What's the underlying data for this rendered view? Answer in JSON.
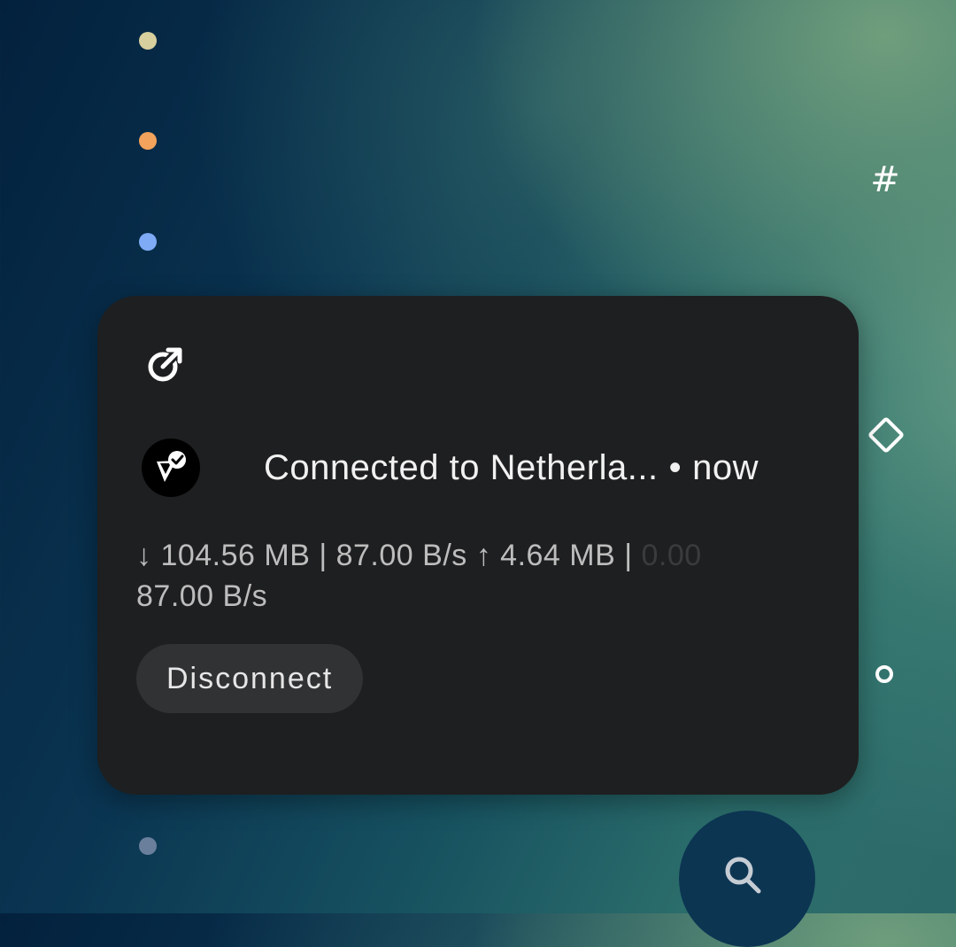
{
  "colors": {
    "dot_beige": "#d8cf9e",
    "dot_orange": "#f3a35c",
    "dot_blue": "#7fabf6",
    "dot_slate": "#6a7f9b",
    "card_bg": "#1e1f20",
    "button_bg": "#303234"
  },
  "side_icons": {
    "hash": "#"
  },
  "notification": {
    "title": "Connected to Netherla...",
    "separator": "•",
    "time": "now",
    "stats_line1": "↓ 104.56 MB | 87.00 B/s  ↑ 4.64 MB |",
    "stats_ghost": "",
    "stats_tail": "0.00",
    "stats_line2": "87.00 B/s",
    "button_label": "Disconnect"
  },
  "icons": {
    "open": "external-open-icon",
    "app": "vpn-app-icon",
    "search": "search-icon"
  }
}
